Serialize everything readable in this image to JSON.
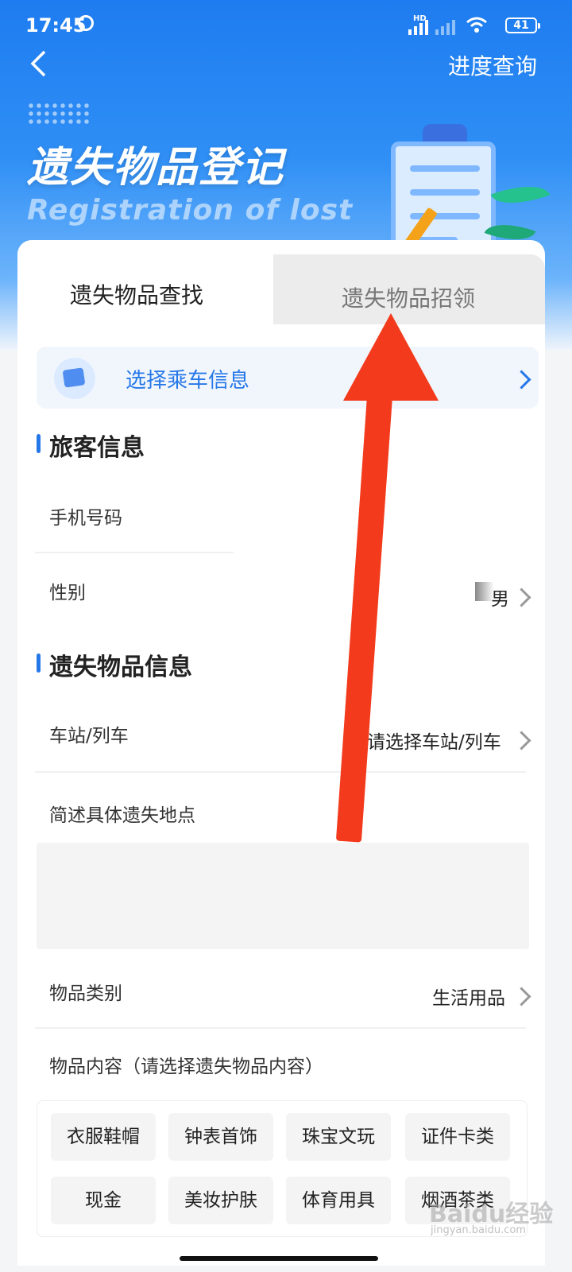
{
  "status_bar": {
    "time": "17:45",
    "hd_label": "HD",
    "battery": "41"
  },
  "header": {
    "progress_query": "进度查询"
  },
  "banner": {
    "title": "遗失物品登记",
    "subtitle": "Registration of lost"
  },
  "tabs": [
    {
      "label": "遗失物品查找",
      "active": true
    },
    {
      "label": "遗失物品招领",
      "active": false
    }
  ],
  "trip": {
    "label": "选择乘车信息"
  },
  "passenger_section": {
    "title": "旅客信息",
    "phone_label": "手机号码",
    "gender_label": "性别",
    "gender_value": "男"
  },
  "item_section": {
    "title": "遗失物品信息",
    "station_label": "车站/列车",
    "station_placeholder": "请选择车站/列车",
    "location_label": "简述具体遗失地点",
    "category_label": "物品类别",
    "category_value": "生活用品",
    "content_label": "物品内容（请选择遗失物品内容）"
  },
  "chips": [
    "衣服鞋帽",
    "钟表首饰",
    "珠宝文玩",
    "证件卡类",
    "现金",
    "美妆护肤",
    "体育用具",
    "烟酒茶类"
  ],
  "watermark": {
    "text": "Baidu经验",
    "sub": "jingyan.baidu.com"
  },
  "colors": {
    "accent": "#2577e8",
    "arrow": "#f33a1c"
  }
}
